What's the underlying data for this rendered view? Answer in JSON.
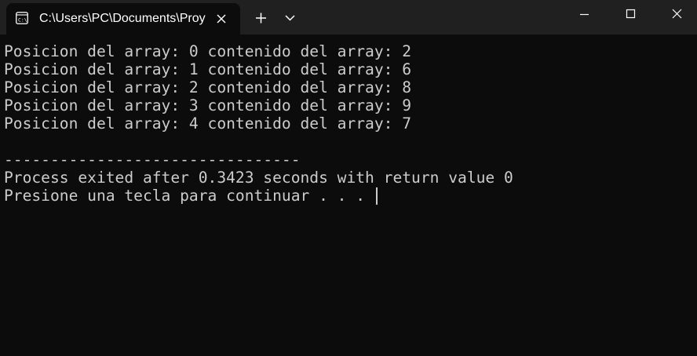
{
  "tab": {
    "title": "C:\\Users\\PC\\Documents\\Proy",
    "icon": "terminal-app-icon"
  },
  "toolbar": {
    "new_tab_icon": "plus-icon",
    "dropdown_icon": "chevron-down-icon"
  },
  "window_controls": {
    "minimize_icon": "minimize-icon",
    "maximize_icon": "maximize-icon",
    "close_icon": "close-icon"
  },
  "console": {
    "lines": [
      "Posicion del array: 0 contenido del array: 2",
      "Posicion del array: 1 contenido del array: 6",
      "Posicion del array: 2 contenido del array: 8",
      "Posicion del array: 3 contenido del array: 9",
      "Posicion del array: 4 contenido del array: 7",
      "",
      "--------------------------------",
      "Process exited after 0.3423 seconds with return value 0",
      "Presione una tecla para continuar . . . "
    ]
  },
  "colors": {
    "background": "#0c0c0c",
    "titlebar": "#202020",
    "text": "#cccccc"
  }
}
